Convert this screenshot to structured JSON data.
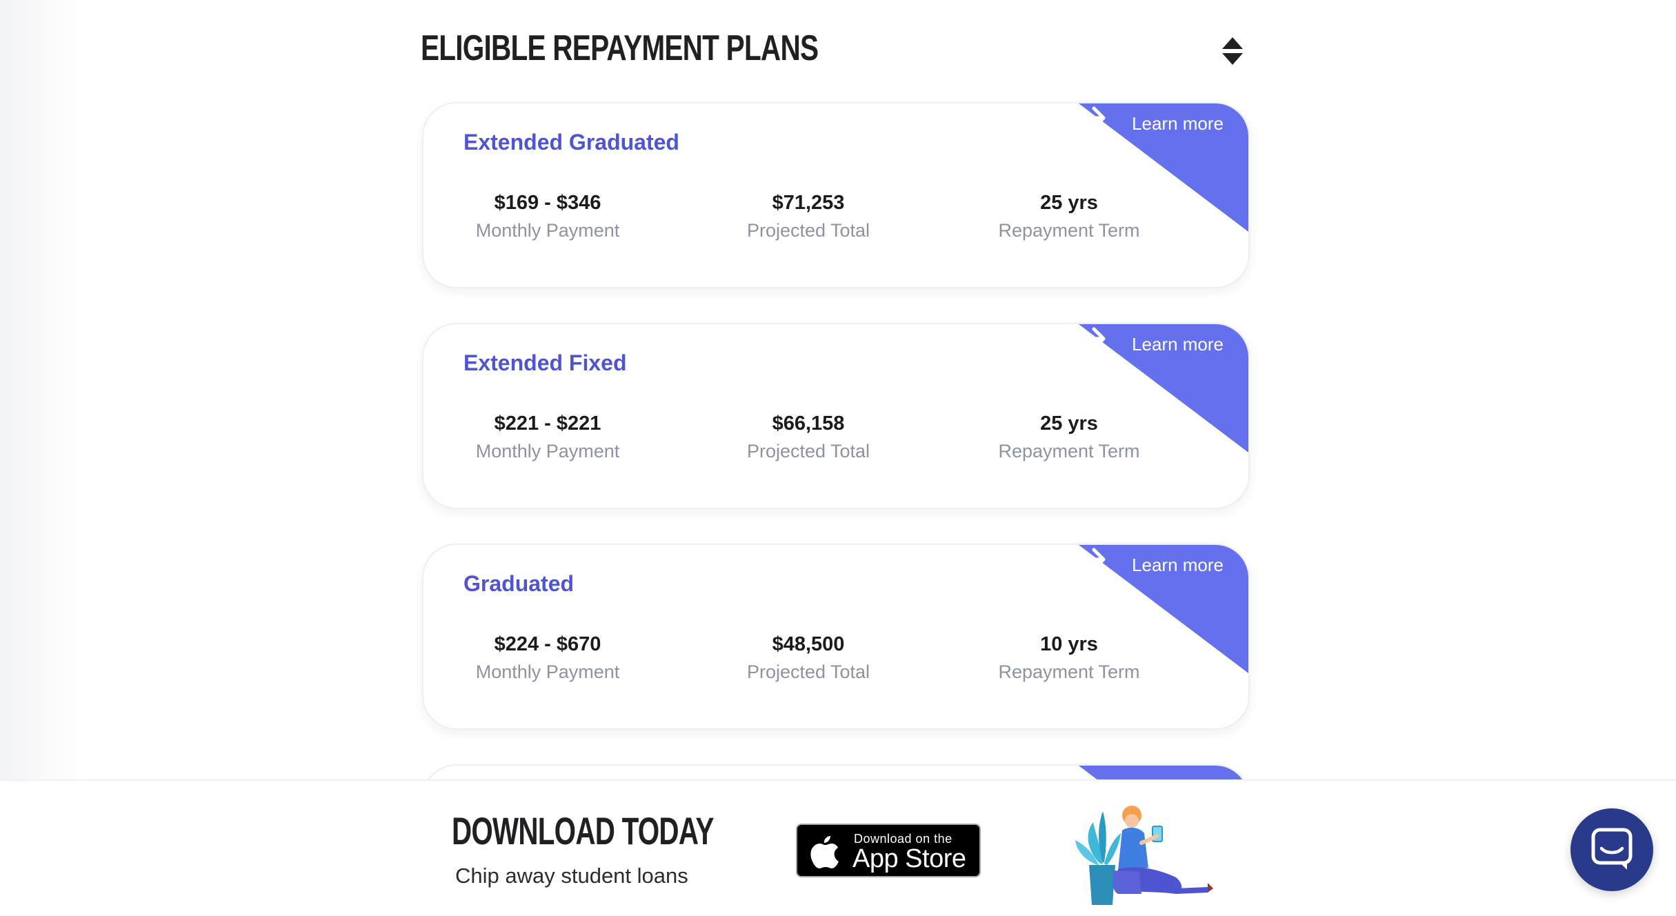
{
  "section": {
    "title": "ELIGIBLE REPAYMENT PLANS",
    "sort_icon": "sort-up-down-icon"
  },
  "plans": [
    {
      "name": "Extended Graduated",
      "learn_more": "Learn more",
      "monthly_payment": "$169 - $346",
      "monthly_payment_label": "Monthly Payment",
      "projected_total": "$71,253",
      "projected_total_label": "Projected Total",
      "repayment_term": "25 yrs",
      "repayment_term_label": "Repayment Term"
    },
    {
      "name": "Extended Fixed",
      "learn_more": "Learn more",
      "monthly_payment": "$221 - $221",
      "monthly_payment_label": "Monthly Payment",
      "projected_total": "$66,158",
      "projected_total_label": "Projected Total",
      "repayment_term": "25 yrs",
      "repayment_term_label": "Repayment Term"
    },
    {
      "name": "Graduated",
      "learn_more": "Learn more",
      "monthly_payment": "$224 - $670",
      "monthly_payment_label": "Monthly Payment",
      "projected_total": "$48,500",
      "projected_total_label": "Projected Total",
      "repayment_term": "10 yrs",
      "repayment_term_label": "Repayment Term"
    }
  ],
  "banner": {
    "heading": "DOWNLOAD TODAY",
    "subheading": "Chip away student loans",
    "app_store_small": "Download on the",
    "app_store_big": "App Store"
  },
  "colors": {
    "accent": "#6470ec",
    "plan_title": "#4f55d1",
    "chat_launcher": "#2a3a8a"
  },
  "icons": {
    "learn_more_arrow": "arrow-right-icon",
    "app_store_logo": "apple-icon",
    "chat": "chat-icon"
  }
}
